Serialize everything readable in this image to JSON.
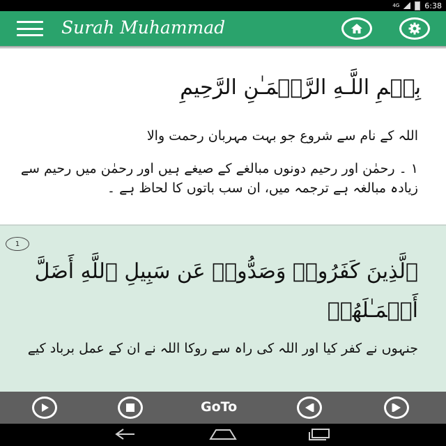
{
  "status_bar": {
    "network": "4G",
    "time": "6:38"
  },
  "app_bar": {
    "title": "Surah Muhammad",
    "background": "#2aa36c",
    "icons": {
      "menu": "hamburger-menu-icon",
      "home": "home-icon",
      "settings": "settings-gear-icon"
    }
  },
  "bismillah": {
    "arabic": "بِسۡمِ اللَّـهِ الرَّحۡمَـٰنِ الرَّحِيمِ",
    "translation": "اللہ کے نام سے شروع جو بہت مہربان رحمت والا",
    "footnote": "١ ۔ رحمٰن اور رحیم دونوں مبالغے کے صیغے ہیں اور رحمٰن میں رحیم سے زیادہ مبالغہ ہے ترجمہ میں، ان سب باتوں کا لحاظ ہے ۔"
  },
  "verse": {
    "number": "1",
    "arabic": "ٱلَّذِينَ كَفَرُوا۟ وَصَدُّوا۟ عَن سَبِيلِ ٱللَّهِ أَضَلَّ أَعۡمَـٰلَهُمۡ",
    "translation": "جنہوں نے کفر کیا اور اللہ کی راہ سے روکا اللہ نے ان کے عمل برباد کیے",
    "background": "#d9ebe1"
  },
  "controls": {
    "goto_label": "GoTo",
    "icons": {
      "play": "play-icon",
      "stop": "stop-icon",
      "previous": "previous-icon",
      "next": "next-icon"
    }
  },
  "nav_bar": {
    "icons": {
      "back": "back-icon",
      "home": "home-nav-icon",
      "recents": "recents-icon"
    }
  }
}
